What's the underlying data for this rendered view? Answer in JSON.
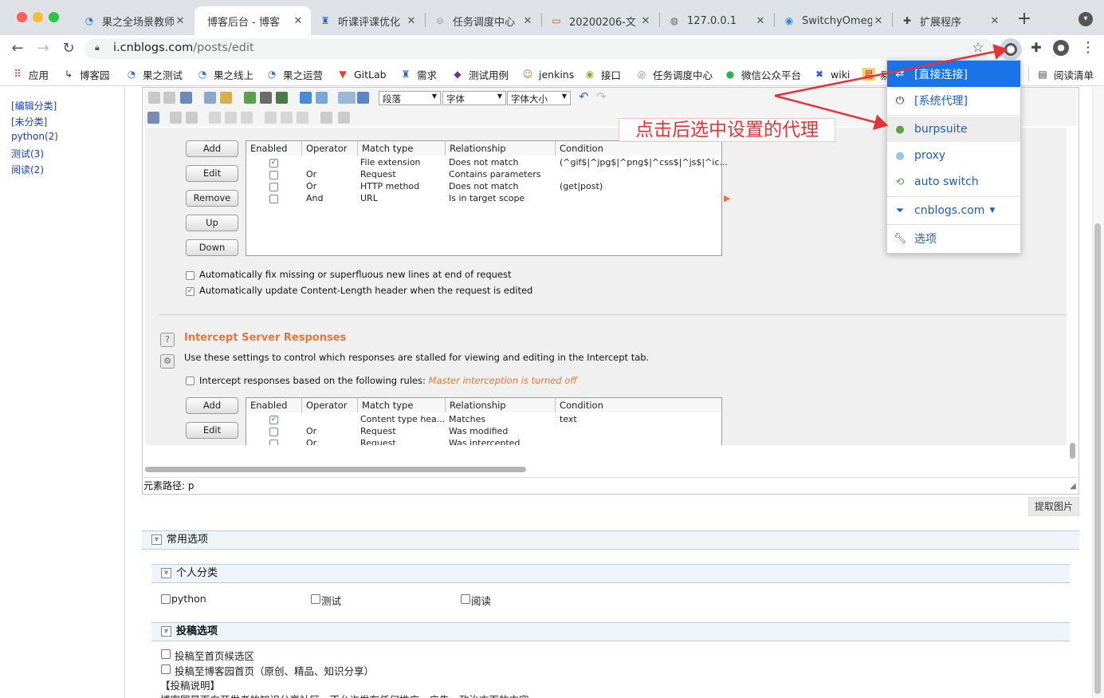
{
  "browser": {
    "tabs": [
      {
        "title": "果之全场景教师",
        "icon": "chrome-swirl-icon"
      },
      {
        "title": "博客后台 - 博客",
        "icon": "none",
        "active": true
      },
      {
        "title": "听课评课优化",
        "icon": "confluence-icon"
      },
      {
        "title": "任务调度中心",
        "icon": "xxl-job-icon"
      },
      {
        "title": "20200206-文",
        "icon": "screen-icon"
      },
      {
        "title": "127.0.0.1",
        "icon": "globe-icon"
      },
      {
        "title": "SwitchyOmega",
        "icon": "switchyomega-icon"
      },
      {
        "title": "扩展程序",
        "icon": "puzzle-icon"
      }
    ],
    "url_host": "i.cnblogs.com",
    "url_path": "/posts/edit",
    "bookmarks": [
      "应用",
      "博客园",
      "果之测试",
      "果之线上",
      "果之运营",
      "GitLab",
      "需求",
      "测试用例",
      "jenkins",
      "接口",
      "任务调度中心",
      "微信公众平台",
      "wiki",
      "易"
    ],
    "reading_list": "阅读清单"
  },
  "sidebar": {
    "categories": [
      "[编辑分类]",
      "[未分类]",
      "python(2)",
      "测试(3)",
      "阅读(2)"
    ]
  },
  "editor": {
    "toolbar_selects": [
      "段落",
      "字体",
      "字体大小"
    ],
    "element_path": "元素路径: p",
    "extract_images": "提取图片"
  },
  "burp": {
    "buttons": [
      "Add",
      "Edit",
      "Remove",
      "Up",
      "Down"
    ],
    "columns": [
      "Enabled",
      "Operator",
      "Match type",
      "Relationship",
      "Condition"
    ],
    "request_rules": [
      {
        "enabled": true,
        "operator": "",
        "match": "File extension",
        "rel": "Does not match",
        "cond": "(^gif$|^jpg$|^png$|^css$|^js$|^ic..."
      },
      {
        "enabled": false,
        "operator": "Or",
        "match": "Request",
        "rel": "Contains parameters",
        "cond": ""
      },
      {
        "enabled": false,
        "operator": "Or",
        "match": "HTTP method",
        "rel": "Does not match",
        "cond": "(get|post)"
      },
      {
        "enabled": false,
        "operator": "And",
        "match": "URL",
        "rel": "Is in target scope",
        "cond": ""
      }
    ],
    "opt_fix_newlines": "Automatically fix missing or superfluous new lines at end of request",
    "opt_update_length": "Automatically update Content-Length header when the request is edited",
    "resp_title": "Intercept Server Responses",
    "resp_desc": "Use these settings to control which responses are stalled for viewing and editing in the Intercept tab.",
    "resp_rules_label": "Intercept responses based on the following rules:",
    "resp_rules_note": "Master interception is turned off",
    "resp_buttons": [
      "Add",
      "Edit"
    ],
    "response_rules": [
      {
        "enabled": true,
        "operator": "",
        "match": "Content type hea...",
        "rel": "Matches",
        "cond": "text"
      },
      {
        "enabled": false,
        "operator": "Or",
        "match": "Request",
        "rel": "Was modified",
        "cond": ""
      },
      {
        "enabled": false,
        "operator": "Or",
        "match": "Request",
        "rel": "Was intercepted",
        "cond": ""
      }
    ]
  },
  "options": {
    "common": "常用选项",
    "personal": "个人分类",
    "personal_items": [
      "python",
      "测试",
      "阅读"
    ],
    "submit": "投稿选项",
    "submit_items": [
      "投稿至首页候选区",
      "投稿至博客园首页（原创、精品、知识分享）"
    ],
    "submit_note_title": "【投稿说明】",
    "submit_note_text": "博客园是面向开发者的知识分享社区，不允许发布任何推广、广告、政治方面的内容。"
  },
  "popup": {
    "items": [
      {
        "label": "[直接连接]",
        "icon": "arrows-icon",
        "selected": true
      },
      {
        "label": "[系统代理]",
        "icon": "power-icon"
      },
      {
        "label": "burpsuite",
        "icon": "globe-green-icon"
      },
      {
        "label": "proxy",
        "icon": "globe-blue-icon"
      },
      {
        "label": "auto switch",
        "icon": "switch-icon"
      },
      {
        "label": "cnblogs.com",
        "icon": "filter-icon"
      },
      {
        "label": "选项",
        "icon": "wrench-icon"
      }
    ]
  },
  "annotation": "点击后选中设置的代理",
  "colors": {
    "accent": "#1a73e8",
    "popup_selected": "#1a73e8",
    "annotation_red": "#e8333a",
    "burp_orange": "#e8773a"
  }
}
